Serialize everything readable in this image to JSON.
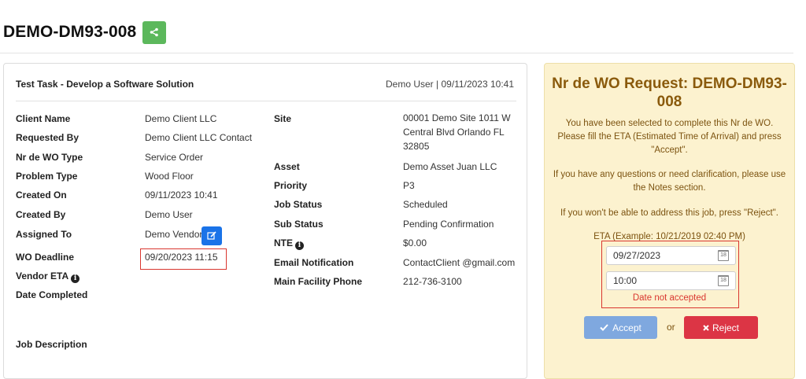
{
  "page": {
    "title": "DEMO-DM93-008"
  },
  "task": {
    "title": "Test Task - Develop a Software Solution",
    "meta": "Demo User | 09/11/2023 10:41",
    "left_fields": [
      {
        "label": "Client Name",
        "value": "Demo Client LLC"
      },
      {
        "label": "Requested By",
        "value": "Demo Client LLC Contact"
      },
      {
        "label": "Nr de WO Type",
        "value": "Service Order"
      },
      {
        "label": "Problem Type",
        "value": "Wood Floor"
      },
      {
        "label": "Created On",
        "value": "09/11/2023 10:41"
      },
      {
        "label": "Created By",
        "value": "Demo User"
      },
      {
        "label": "Assigned To",
        "value": "Demo Vendor"
      },
      {
        "label": "WO Deadline",
        "value": "09/20/2023 11:15"
      },
      {
        "label": "Vendor ETA",
        "value": ""
      },
      {
        "label": "Date Completed",
        "value": ""
      }
    ],
    "right_fields": [
      {
        "label": "Site",
        "value": "00001 Demo Site 1011 W Central Blvd Orlando FL 32805"
      },
      {
        "label": "Asset",
        "value": "Demo Asset Juan LLC"
      },
      {
        "label": "Priority",
        "value": "P3"
      },
      {
        "label": "Job Status",
        "value": "Scheduled"
      },
      {
        "label": "Sub Status",
        "value": "Pending Confirmation"
      },
      {
        "label": "NTE",
        "value": "$0.00"
      },
      {
        "label": "Email Notification",
        "value": "ContactClient @gmail.com"
      },
      {
        "label": "Main Facility Phone",
        "value": "212-736-3100"
      }
    ],
    "job_description_label": "Job Description"
  },
  "panel": {
    "title": "Nr de WO Request: DEMO-DM93-008",
    "p1": "You have been selected to complete this Nr de WO. Please fill the ETA (Estimated Time of Arrival) and press \"Accept\".",
    "p2": "If you have any questions or need clarification, please use the Notes section.",
    "p3": "If you won't be able to address this job, press \"Reject\".",
    "eta_label": "ETA (Example: 10/21/2019 02:40 PM)",
    "date_value": "09/27/2023",
    "time_value": "10:00",
    "error": "Date not accepted",
    "accept_label": "Accept",
    "or_label": "or",
    "reject_label": "Reject",
    "calendar_day": "18"
  },
  "colors": {
    "share": "#5cb85c",
    "edit": "#1a73e8",
    "panel_bg": "#fcf2cf",
    "panel_text": "#8a5a0c",
    "error": "#d9362f",
    "accept": "#7fa8df",
    "reject": "#dc3545"
  },
  "icons": {
    "share": "share-icon",
    "edit": "edit-icon",
    "info": "info-icon",
    "calendar": "calendar-icon",
    "check": "check-icon",
    "times": "times-icon"
  }
}
